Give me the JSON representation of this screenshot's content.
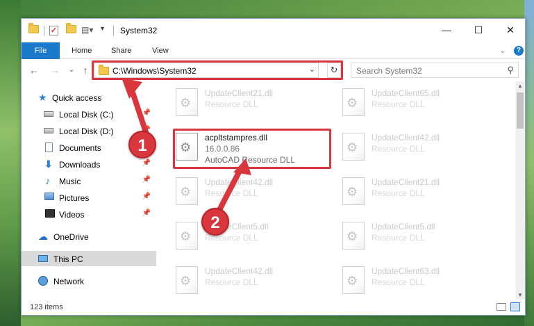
{
  "window": {
    "title": "System32",
    "minimize": "—",
    "maximize": "☐",
    "close": "✕"
  },
  "ribbon": {
    "tabs": [
      "File",
      "Home",
      "Share",
      "View"
    ],
    "expand": "⌄",
    "help": "?"
  },
  "nav": {
    "back": "←",
    "forward": "→",
    "recent": "⌄",
    "up": "↑"
  },
  "address": {
    "path": "C:\\Windows\\System32",
    "dropdown": "⌄",
    "refresh": "↻"
  },
  "search": {
    "placeholder": "Search System32",
    "icon": "search-icon"
  },
  "sidebar": {
    "items": [
      {
        "label": "Quick access",
        "icon": "star-icon",
        "pinned": false
      },
      {
        "label": "Local Disk (C:)",
        "icon": "drive-icon",
        "pinned": true
      },
      {
        "label": "Local Disk (D:)",
        "icon": "drive-icon",
        "pinned": true
      },
      {
        "label": "Documents",
        "icon": "document-icon",
        "pinned": true
      },
      {
        "label": "Downloads",
        "icon": "download-icon",
        "pinned": true
      },
      {
        "label": "Music",
        "icon": "music-icon",
        "pinned": true
      },
      {
        "label": "Pictures",
        "icon": "pictures-icon",
        "pinned": true
      },
      {
        "label": "Videos",
        "icon": "video-icon",
        "pinned": true
      },
      {
        "label": "OneDrive",
        "icon": "cloud-icon",
        "pinned": false
      },
      {
        "label": "This PC",
        "icon": "computer-icon",
        "pinned": false,
        "selected": true
      },
      {
        "label": "Network",
        "icon": "network-icon",
        "pinned": false
      }
    ],
    "pin_glyph": "📌"
  },
  "files": {
    "focus": {
      "name": "acpltstampres.dll",
      "version": "16.0.0.86",
      "type": "AutoCAD Resource DLL"
    },
    "items": [
      {
        "name": "UpdateClient21.dll",
        "type": "Resource DLL"
      },
      {
        "name": "UpdateClient65.dll",
        "type": "Resource DLL"
      },
      {
        "name": "UpdateClient42.dll",
        "type": "Resource DLL"
      },
      {
        "name": "UpdateClient42.dll",
        "type": "Resource DLL"
      },
      {
        "name": "UpdateClient21.dll",
        "type": "Resource DLL"
      },
      {
        "name": "UpdateClient5.dll",
        "type": "Resource DLL"
      },
      {
        "name": "UpdateClient5.dll",
        "type": "Resource DLL"
      },
      {
        "name": "UpdateClient42.dll",
        "type": "Resource DLL"
      },
      {
        "name": "UpdateClient63.dll",
        "type": "Resource DLL"
      }
    ]
  },
  "status": {
    "count": "123 items"
  },
  "callouts": [
    "1",
    "2"
  ],
  "colors": {
    "accent": "#1979ca",
    "highlight": "#d9363e"
  }
}
